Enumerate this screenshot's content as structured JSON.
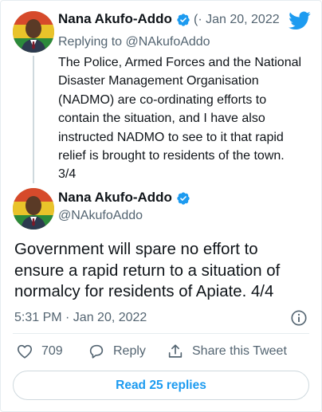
{
  "top_tweet": {
    "author_name": "Nana Akufo-Addo",
    "meta_text": "(· Jan 20, 2022",
    "replying_prefix": "Replying to",
    "replying_handle": "@NAkufoAddo",
    "body": "The Police, Armed Forces and the National Disaster Management Organisation (NADMO) are co-ordinating efforts to contain the situation, and I have also instructed NADMO to see to it that rapid relief is brought to residents of the town. 3/4"
  },
  "main_tweet": {
    "author_name": "Nana Akufo-Addo",
    "author_handle": "@NAkufoAddo",
    "body": "Government will spare no effort to ensure a rapid return to a situation of normalcy for residents of Apiate. 4/4",
    "timestamp": "5:31 PM · Jan 20, 2022"
  },
  "actions": {
    "like_count": "709",
    "reply_label": "Reply",
    "share_label": "Share this Tweet"
  },
  "read_replies_label": "Read 25 replies",
  "icons": {
    "verified": "verified-badge-icon",
    "twitter": "twitter-bird-icon",
    "info": "info-icon",
    "like": "heart-icon",
    "reply": "reply-bubble-icon",
    "share": "share-icon"
  },
  "colors": {
    "brand_blue": "#1d9bf0",
    "text_primary": "#0f1419",
    "text_secondary": "#536471",
    "border": "#e6ecf0"
  }
}
